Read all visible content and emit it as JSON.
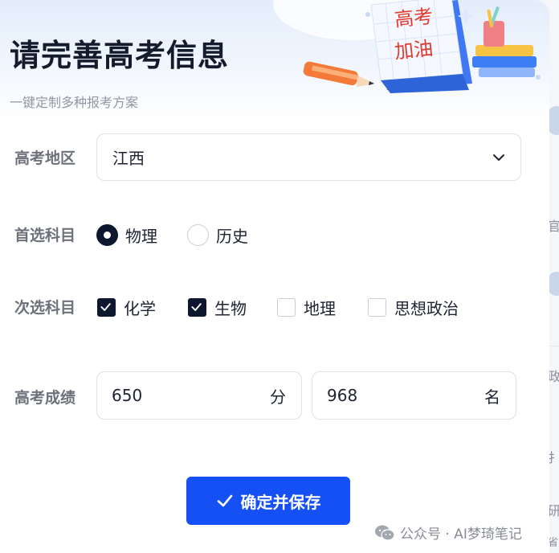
{
  "header": {
    "title": "请完善高考信息",
    "subtitle": "一键定制多种报考方案",
    "illustration_text": [
      "高考",
      "加油"
    ]
  },
  "region": {
    "label": "高考地区",
    "value": "江西"
  },
  "primary_subject": {
    "label": "首选科目",
    "options": [
      {
        "label": "物理",
        "selected": true
      },
      {
        "label": "历史",
        "selected": false
      }
    ]
  },
  "secondary_subject": {
    "label": "次选科目",
    "options": [
      {
        "label": "化学",
        "checked": true
      },
      {
        "label": "生物",
        "checked": true
      },
      {
        "label": "地理",
        "checked": false
      },
      {
        "label": "思想政治",
        "checked": false
      }
    ]
  },
  "score": {
    "label": "高考成绩",
    "score_value": "650",
    "score_unit": "分",
    "rank_value": "968",
    "rank_unit": "名"
  },
  "actions": {
    "save_label": "确定并保存"
  },
  "watermark": {
    "text": "公众号 · AI梦琦笔记"
  },
  "background_fragments": [
    "官",
    "政",
    "扌",
    "研",
    "省"
  ],
  "colors": {
    "primary": "#1550f5",
    "checked": "#0e1730",
    "label": "#6c717a",
    "title": "#141b2c"
  }
}
